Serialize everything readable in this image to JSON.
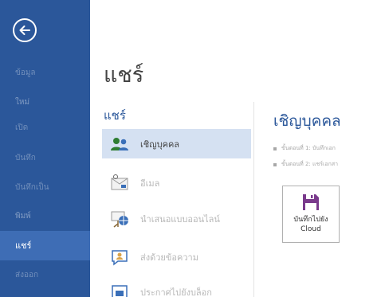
{
  "nav": {
    "items": [
      {
        "label": "ข้อมูล"
      },
      {
        "label": "ใหม่"
      },
      {
        "label": "เปิด"
      },
      {
        "label": "บันทึก"
      },
      {
        "label": "บันทึกเป็น"
      },
      {
        "label": "พิมพ์"
      },
      {
        "label": "แชร์"
      },
      {
        "label": "ส่งออก"
      }
    ],
    "active_index": 6
  },
  "main": {
    "title": "แชร์",
    "section_label": "แชร์",
    "options": [
      {
        "label": "เชิญบุคคล",
        "icon": "people-icon",
        "selected": true
      },
      {
        "label": "อีเมล",
        "icon": "email-icon",
        "selected": false
      },
      {
        "label": "นำเสนอแบบออนไลน์",
        "icon": "present-online-icon",
        "selected": false
      },
      {
        "label": "ส่งด้วยข้อความ",
        "icon": "message-icon",
        "selected": false
      },
      {
        "label": "ประกาศไปยังบล็อก",
        "icon": "blog-icon",
        "selected": false
      }
    ]
  },
  "panel": {
    "title": "เชิญบุคคล",
    "steps": [
      {
        "text": "ขั้นตอนที่ 1: บันทึกเอก"
      },
      {
        "text": "ขั้นตอนที่ 2: แชร์เอกสา"
      }
    ],
    "save_button": {
      "line1": "บันทึกไปยัง",
      "line2": "Cloud",
      "icon": "floppy-disk-icon"
    }
  },
  "colors": {
    "nav_bg": "#2b579a",
    "nav_active": "#3e6db5",
    "accent": "#2b579a",
    "selected_bg": "#d5e1f2"
  }
}
